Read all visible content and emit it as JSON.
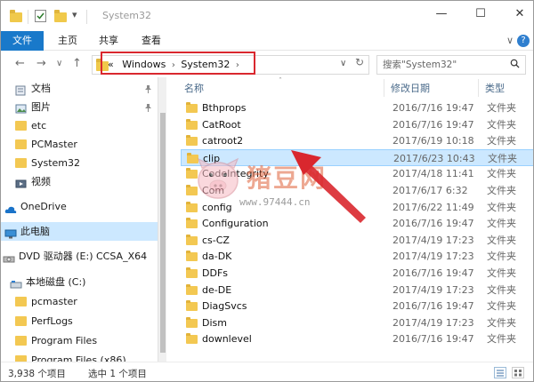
{
  "window": {
    "title": "System32"
  },
  "quick_access": {
    "dropdown_glyph": "▾"
  },
  "window_controls": {
    "minimize": "—",
    "maximize": "☐",
    "close": "✕"
  },
  "ribbon": {
    "file_tab": "文件",
    "tabs": [
      "主页",
      "共享",
      "查看"
    ],
    "expand_glyph": "∨",
    "help_glyph": "?"
  },
  "nav": {
    "back": "←",
    "forward": "→",
    "recent": "∨",
    "up": "↑",
    "breadcrumb": [
      "«",
      "Windows",
      "System32"
    ],
    "breadcrumb_sep": "›",
    "addr_dropdown": "∨",
    "refresh": "↻",
    "search_placeholder": "搜索\"System32\""
  },
  "sidebar": {
    "items": [
      {
        "label": "文档",
        "icon": "documents-icon",
        "pinned": true
      },
      {
        "label": "图片",
        "icon": "pictures-icon",
        "pinned": true
      },
      {
        "label": "etc",
        "icon": "folder-icon",
        "pinned": false
      },
      {
        "label": "PCMaster",
        "icon": "folder-icon",
        "pinned": false
      },
      {
        "label": "System32",
        "icon": "folder-icon",
        "pinned": false
      },
      {
        "label": "视频",
        "icon": "videos-icon",
        "pinned": false
      },
      {
        "label": "OneDrive",
        "icon": "onedrive-icon",
        "pinned": false
      },
      {
        "label": "此电脑",
        "icon": "this-pc-icon",
        "pinned": false
      },
      {
        "label": "DVD 驱动器 (E:) CCSA_X64",
        "icon": "dvd-drive-icon",
        "pinned": false
      },
      {
        "label": "本地磁盘 (C:)",
        "icon": "local-disk-icon",
        "pinned": false
      },
      {
        "label": "pcmaster",
        "icon": "folder-icon",
        "pinned": false
      },
      {
        "label": "PerfLogs",
        "icon": "folder-icon",
        "pinned": false
      },
      {
        "label": "Program Files",
        "icon": "folder-icon",
        "pinned": false
      },
      {
        "label": "Program Files (x86)",
        "icon": "folder-icon",
        "pinned": false
      }
    ],
    "pin_glyph": "📌"
  },
  "columns": {
    "name": "名称",
    "date": "修改日期",
    "type": "类型",
    "sort_glyph": "˄"
  },
  "files": [
    {
      "name": "Bthprops",
      "date": "2016/7/16 19:47",
      "type": "文件夹"
    },
    {
      "name": "CatRoot",
      "date": "2016/7/16 19:47",
      "type": "文件夹"
    },
    {
      "name": "catroot2",
      "date": "2017/6/19 10:18",
      "type": "文件夹"
    },
    {
      "name": "clip",
      "date": "2017/6/23 10:43",
      "type": "文件夹"
    },
    {
      "name": "CodeIntegrity",
      "date": "2017/4/18 11:41",
      "type": "文件夹"
    },
    {
      "name": "Com",
      "date": "2017/6/17 6:32",
      "type": "文件夹"
    },
    {
      "name": "config",
      "date": "2017/6/22 11:49",
      "type": "文件夹"
    },
    {
      "name": "Configuration",
      "date": "2016/7/16 19:47",
      "type": "文件夹"
    },
    {
      "name": "cs-CZ",
      "date": "2017/4/19 17:23",
      "type": "文件夹"
    },
    {
      "name": "da-DK",
      "date": "2017/4/19 17:23",
      "type": "文件夹"
    },
    {
      "name": "DDFs",
      "date": "2016/7/16 19:47",
      "type": "文件夹"
    },
    {
      "name": "de-DE",
      "date": "2017/4/19 17:23",
      "type": "文件夹"
    },
    {
      "name": "DiagSvcs",
      "date": "2016/7/16 19:47",
      "type": "文件夹"
    },
    {
      "name": "Dism",
      "date": "2017/4/19 17:23",
      "type": "文件夹"
    },
    {
      "name": "downlevel",
      "date": "2016/7/16 19:47",
      "type": "文件夹"
    }
  ],
  "selected_file": "clip",
  "watermark": {
    "brand": "猪豆网",
    "url": "www.97444.cn"
  },
  "status": {
    "item_count": "3,938 个项目",
    "selection": "选中 1 个项目"
  },
  "colors": {
    "accent": "#1979ca",
    "selection": "#cce8ff",
    "highlight": "#d9272e",
    "folder": "#f3c852"
  }
}
